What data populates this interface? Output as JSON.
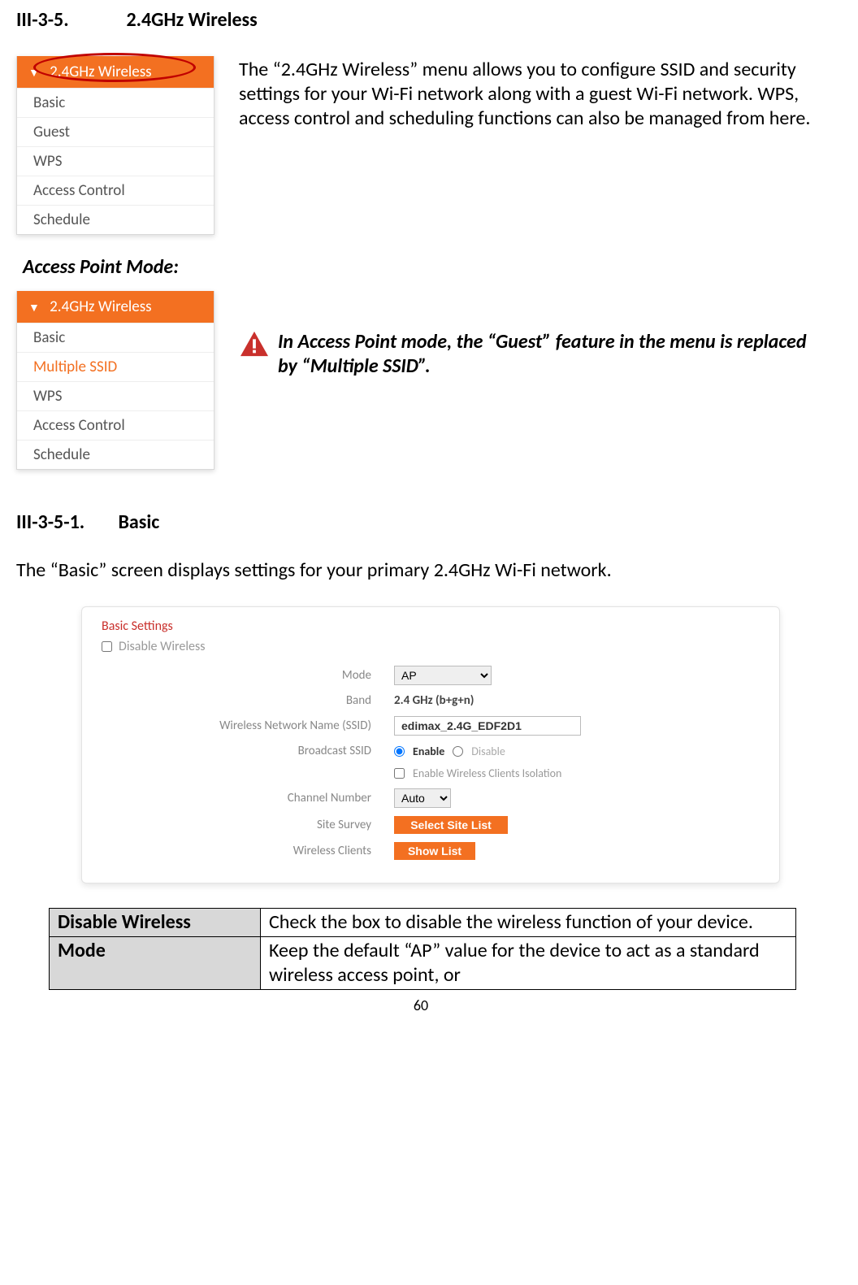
{
  "heading1": {
    "num": "III-3-5.",
    "title": "2.4GHz Wireless"
  },
  "menu1": {
    "header": "2.4GHz Wireless",
    "items": [
      "Basic",
      "Guest",
      "WPS",
      "Access Control",
      "Schedule"
    ]
  },
  "intro1": "The “2.4GHz Wireless” menu allows you to configure SSID and security settings for your Wi-Fi network along with a guest Wi-Fi network. WPS, access control and scheduling functions can also be managed from here.",
  "modeHeading": "Access Point Mode:",
  "menu2": {
    "header": "2.4GHz Wireless",
    "items": [
      "Basic",
      "Multiple SSID",
      "WPS",
      "Access Control",
      "Schedule"
    ],
    "highlightedIndex": 1
  },
  "note": "In Access Point mode, the “Guest” feature in the menu is replaced by “Multiple SSID”.",
  "heading2": {
    "num": "III-3-5-1.",
    "title": "Basic"
  },
  "body2": "The “Basic” screen displays settings for your primary 2.4GHz Wi-Fi network.",
  "settings": {
    "title": "Basic Settings",
    "disableLabel": "Disable  Wireless",
    "rows": {
      "modeLabel": "Mode",
      "modeValue": "AP",
      "bandLabel": "Band",
      "bandValue": "2.4 GHz (b+g+n)",
      "ssidLabel": "Wireless Network Name  (SSID)",
      "ssidValue": "edimax_2.4G_EDF2D1",
      "broadcastLabel": "Broadcast SSID",
      "enable": "Enable",
      "disable": "Disable",
      "isolationLabel": "Enable Wireless Clients Isolation",
      "channelLabel": "Channel Number",
      "channelValue": "Auto",
      "surveyLabel": "Site Survey",
      "surveyBtn": "Select Site List",
      "clientsLabel": "Wireless Clients",
      "clientsBtn": "Show List"
    }
  },
  "descTable": [
    {
      "term": "Disable Wireless",
      "desc": "Check the box to disable the wireless function of your device."
    },
    {
      "term": "Mode",
      "desc": "Keep the default “AP” value for the device to act as a standard wireless access point, or"
    }
  ],
  "pageNumber": "60"
}
